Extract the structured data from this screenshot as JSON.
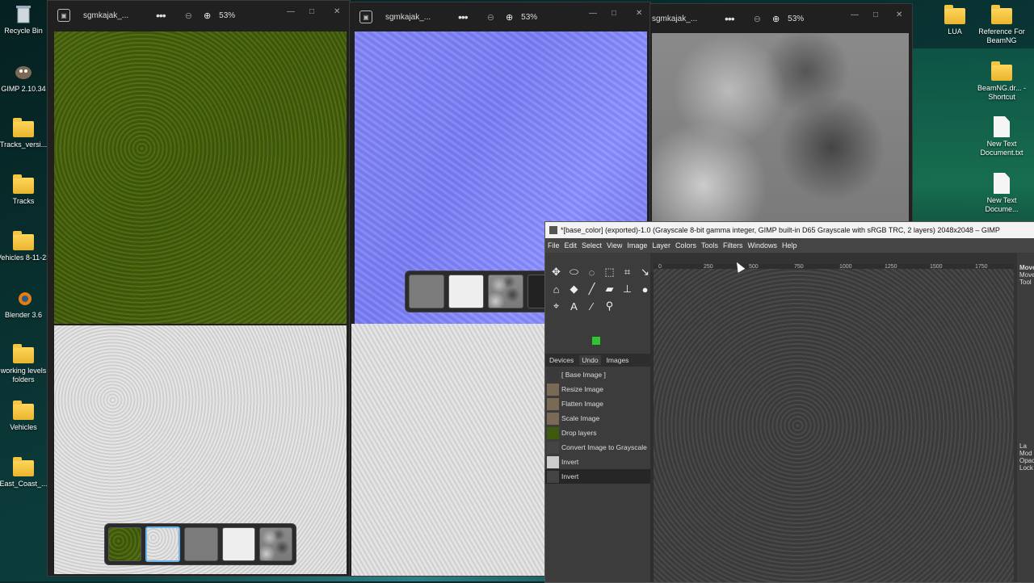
{
  "desktop": {
    "left_icons": [
      {
        "label": "Recycle Bin",
        "icon": "recycle-bin-icon"
      },
      {
        "label": "GIMP 2.10.34",
        "icon": "gimp-icon"
      },
      {
        "label": "Tracks_versi...",
        "icon": "folder-icon"
      },
      {
        "label": "Tracks",
        "icon": "folder-icon"
      },
      {
        "label": "Vehicles 8-11-23",
        "icon": "folder-icon"
      },
      {
        "label": "Blender 3.6",
        "icon": "blender-icon"
      },
      {
        "label": "working levels folders",
        "icon": "folder-icon"
      },
      {
        "label": "Vehicles",
        "icon": "folder-icon"
      },
      {
        "label": "East_Coast_...",
        "icon": "folder-icon"
      }
    ],
    "right_icons": [
      {
        "label": "LUA",
        "icon": "folder-icon"
      },
      {
        "label": "Reference For BeamNG",
        "icon": "folder-icon"
      },
      {
        "label": "BeamNG.dr... - Shortcut",
        "icon": "folder-shortcut-icon"
      },
      {
        "label": "New Text Document.txt",
        "icon": "text-document-icon"
      },
      {
        "label": "New Text Docume...",
        "icon": "text-document-icon"
      }
    ]
  },
  "photo_windows": [
    {
      "title": "sgmkajak_...",
      "zoom": "53%"
    },
    {
      "title": "sgmkajak_...",
      "zoom": "53%"
    },
    {
      "title": "sgmkajak_...",
      "zoom": "53%"
    }
  ],
  "window_controls": {
    "minimize": "—",
    "maximize": "□",
    "close": "✕"
  },
  "gimp": {
    "title": "*[base_color] (exported)-1.0 (Grayscale 8-bit gamma integer, GIMP built-in D65 Grayscale with sRGB TRC, 2 layers) 2048x2048 – GIMP",
    "menu": [
      "File",
      "Edit",
      "Select",
      "View",
      "Image",
      "Layer",
      "Colors",
      "Tools",
      "Filters",
      "Windows",
      "Help"
    ],
    "tabs": [
      "Devices",
      "Undo",
      "Images"
    ],
    "history": [
      {
        "label": "[ Base Image ]",
        "color": "#3a3a3a"
      },
      {
        "label": "Resize Image",
        "color": "#7a6a55"
      },
      {
        "label": "Flatten Image",
        "color": "#7a6a55"
      },
      {
        "label": "Scale Image",
        "color": "#7a6a55"
      },
      {
        "label": "Drop layers",
        "color": "#3d5a10"
      },
      {
        "label": "Convert Image to Grayscale",
        "color": "#444444"
      },
      {
        "label": "Invert",
        "color": "#cccccc"
      },
      {
        "label": "Invert",
        "color": "#444444"
      }
    ],
    "ruler_ticks": [
      "0",
      "250",
      "500",
      "750",
      "1000",
      "1250",
      "1500",
      "1750"
    ],
    "right_panel": [
      "Move",
      "Move",
      "Tool",
      "La",
      "Mod",
      "Opac",
      "Lock"
    ]
  }
}
